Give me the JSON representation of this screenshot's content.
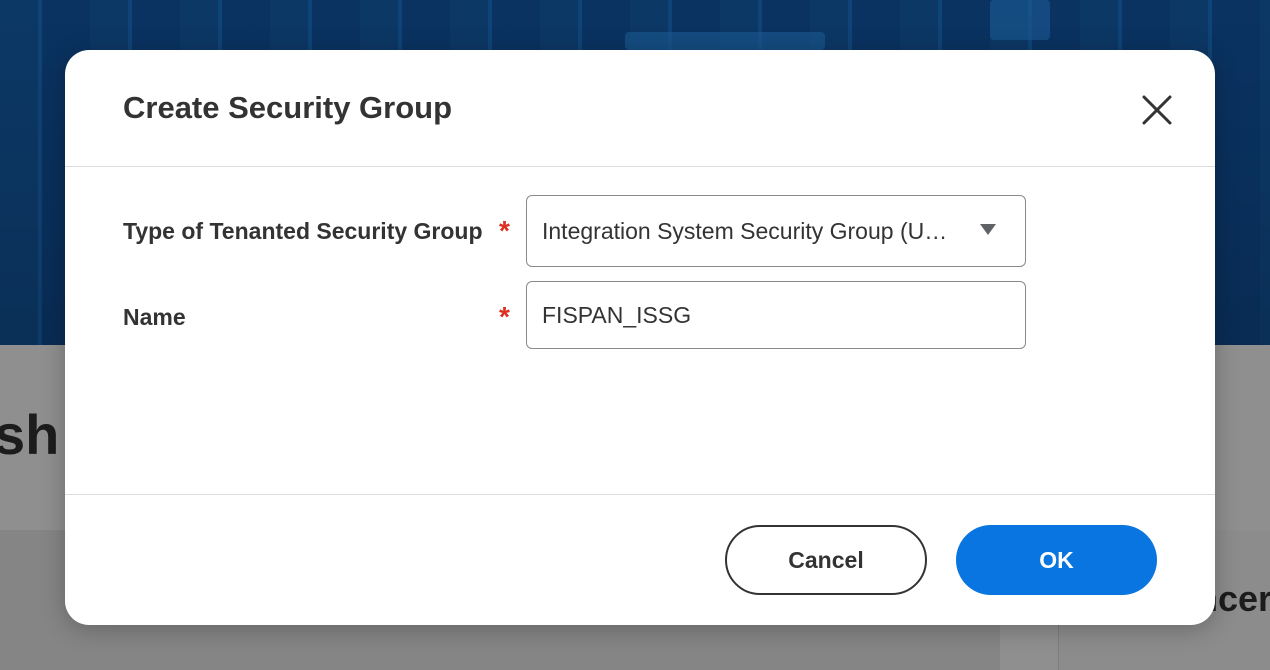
{
  "background": {
    "page_title_fragment": "sh",
    "right_card_fragment": "ncer"
  },
  "dialog": {
    "title": "Create Security Group",
    "close_icon": "close-icon",
    "fields": {
      "type": {
        "label": "Type of Tenanted Security Group",
        "required_marker": "*",
        "selected_value": "Integration System Security Group (U…",
        "dropdown_icon": "caret-down-icon"
      },
      "name": {
        "label": "Name",
        "required_marker": "*",
        "value": "FISPAN_ISSG"
      }
    },
    "buttons": {
      "cancel_label": "Cancel",
      "ok_label": "OK"
    }
  },
  "colors": {
    "primary_button": "#0875e1",
    "required_star": "#de2e21",
    "hero_background": "#0d3a6a",
    "overlay_gray": "#8f8f8f"
  }
}
